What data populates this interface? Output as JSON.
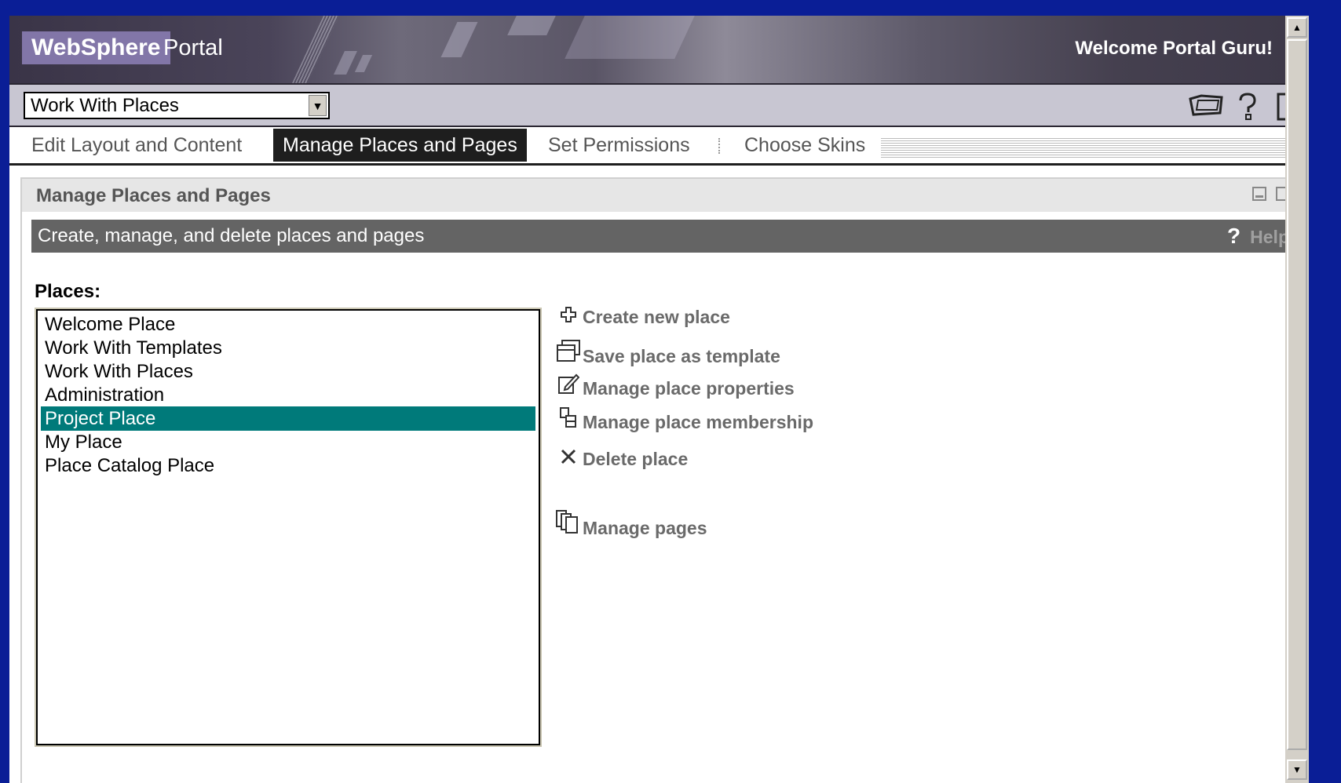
{
  "banner": {
    "brand": "WebSphere",
    "product": "Portal",
    "welcome": "Welcome Portal Guru!"
  },
  "toolbar": {
    "place_select_value": "Work With Places",
    "icons": [
      "new-place-icon",
      "help-icon",
      "logout-icon"
    ]
  },
  "tabs": [
    {
      "label": "Edit Layout and Content",
      "active": false
    },
    {
      "label": "Manage Places and Pages",
      "active": true
    },
    {
      "label": "Set Permissions",
      "active": false
    },
    {
      "label": "Choose Skins",
      "active": false
    }
  ],
  "portlet": {
    "title": "Manage Places and Pages",
    "description": "Create, manage, and delete places and pages",
    "help_label": "Help",
    "help_glyph": "?"
  },
  "places": {
    "label": "Places:",
    "items": [
      "Welcome Place",
      "Work With Templates",
      "Work With Places",
      "Administration",
      "Project Place",
      "My Place",
      "Place Catalog Place"
    ],
    "selected": "Project Place"
  },
  "actions": [
    {
      "label": "Create new place",
      "icon": "plus-icon"
    },
    {
      "label": "Save place as template",
      "icon": "template-icon"
    },
    {
      "label": "Manage place properties",
      "icon": "edit-icon"
    },
    {
      "label": "Manage place membership",
      "icon": "membership-icon"
    },
    {
      "label": "Delete place",
      "icon": "delete-icon"
    },
    {
      "label": "Manage pages",
      "icon": "pages-icon"
    }
  ],
  "colors": {
    "outer_background": "#0a1e96",
    "selected_row": "#007a7a",
    "active_tab": "#1e1e1e",
    "description_bar": "#646464"
  }
}
